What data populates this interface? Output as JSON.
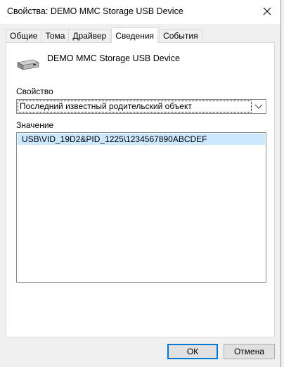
{
  "window": {
    "title": "Свойства: DEMO MMC Storage USB Device"
  },
  "tabs": [
    {
      "label": "Общие",
      "active": false
    },
    {
      "label": "Тома",
      "active": false
    },
    {
      "label": "Драйвер",
      "active": false
    },
    {
      "label": "Сведения",
      "active": true
    },
    {
      "label": "События",
      "active": false
    }
  ],
  "device": {
    "name": "DEMO MMC Storage USB Device",
    "icon": "usb-drive-icon"
  },
  "property": {
    "label": "Свойство",
    "selected": "Последний известный родительский объект"
  },
  "value": {
    "label": "Значение",
    "items": [
      "USB\\VID_19D2&PID_1225\\1234567890ABCDEF"
    ]
  },
  "buttons": {
    "ok": "ОК",
    "cancel": "Отмена"
  },
  "colors": {
    "selection": "#cce8ff",
    "default_button_border": "#0078d4",
    "window_bg": "#f0f0f0"
  }
}
